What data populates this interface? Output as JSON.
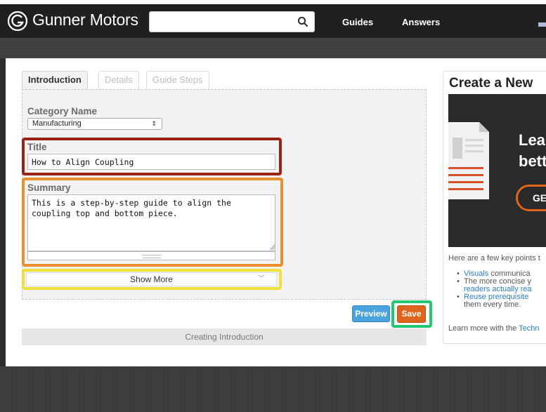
{
  "header": {
    "brand": "Gunner Motors",
    "search_placeholder": "",
    "nav": [
      "Guides",
      "Answers"
    ]
  },
  "tabs": [
    "Introduction",
    "Details",
    "Guide Steps"
  ],
  "form": {
    "category_label": "Category Name",
    "category_value": "Manufacturing",
    "title_label": "Title",
    "title_value": "How to Align Coupling",
    "summary_label": "Summary",
    "summary_value": "This is a step-by-step guide to align the coupling top and bottom piece.",
    "show_more": "Show More"
  },
  "actions": {
    "preview": "Preview",
    "save": "Save",
    "status": "Creating Introduction"
  },
  "sidebar": {
    "title": "Create a New",
    "promo_line1": "Lea",
    "promo_line2": "bett",
    "promo_button": "GE",
    "intro": "Here are a few key points t",
    "bullets": [
      {
        "link": "Visuals",
        "text": " communica"
      },
      {
        "link": "",
        "text": "The more concise y"
      },
      {
        "link": "readers actually rea",
        "text": ""
      },
      {
        "link": "Reuse prerequisite",
        "text": ""
      },
      {
        "link": "",
        "text": "them every time."
      }
    ],
    "learn_more_prefix": "Learn more with the ",
    "learn_more_link": "Techn"
  },
  "colors": {
    "highlight_title": "#9b2316",
    "highlight_summary": "#eb8e2e",
    "highlight_show_more": "#eee23a",
    "highlight_save": "#24c872",
    "save_button": "#e0651c",
    "preview_button": "#4aa3dd"
  }
}
